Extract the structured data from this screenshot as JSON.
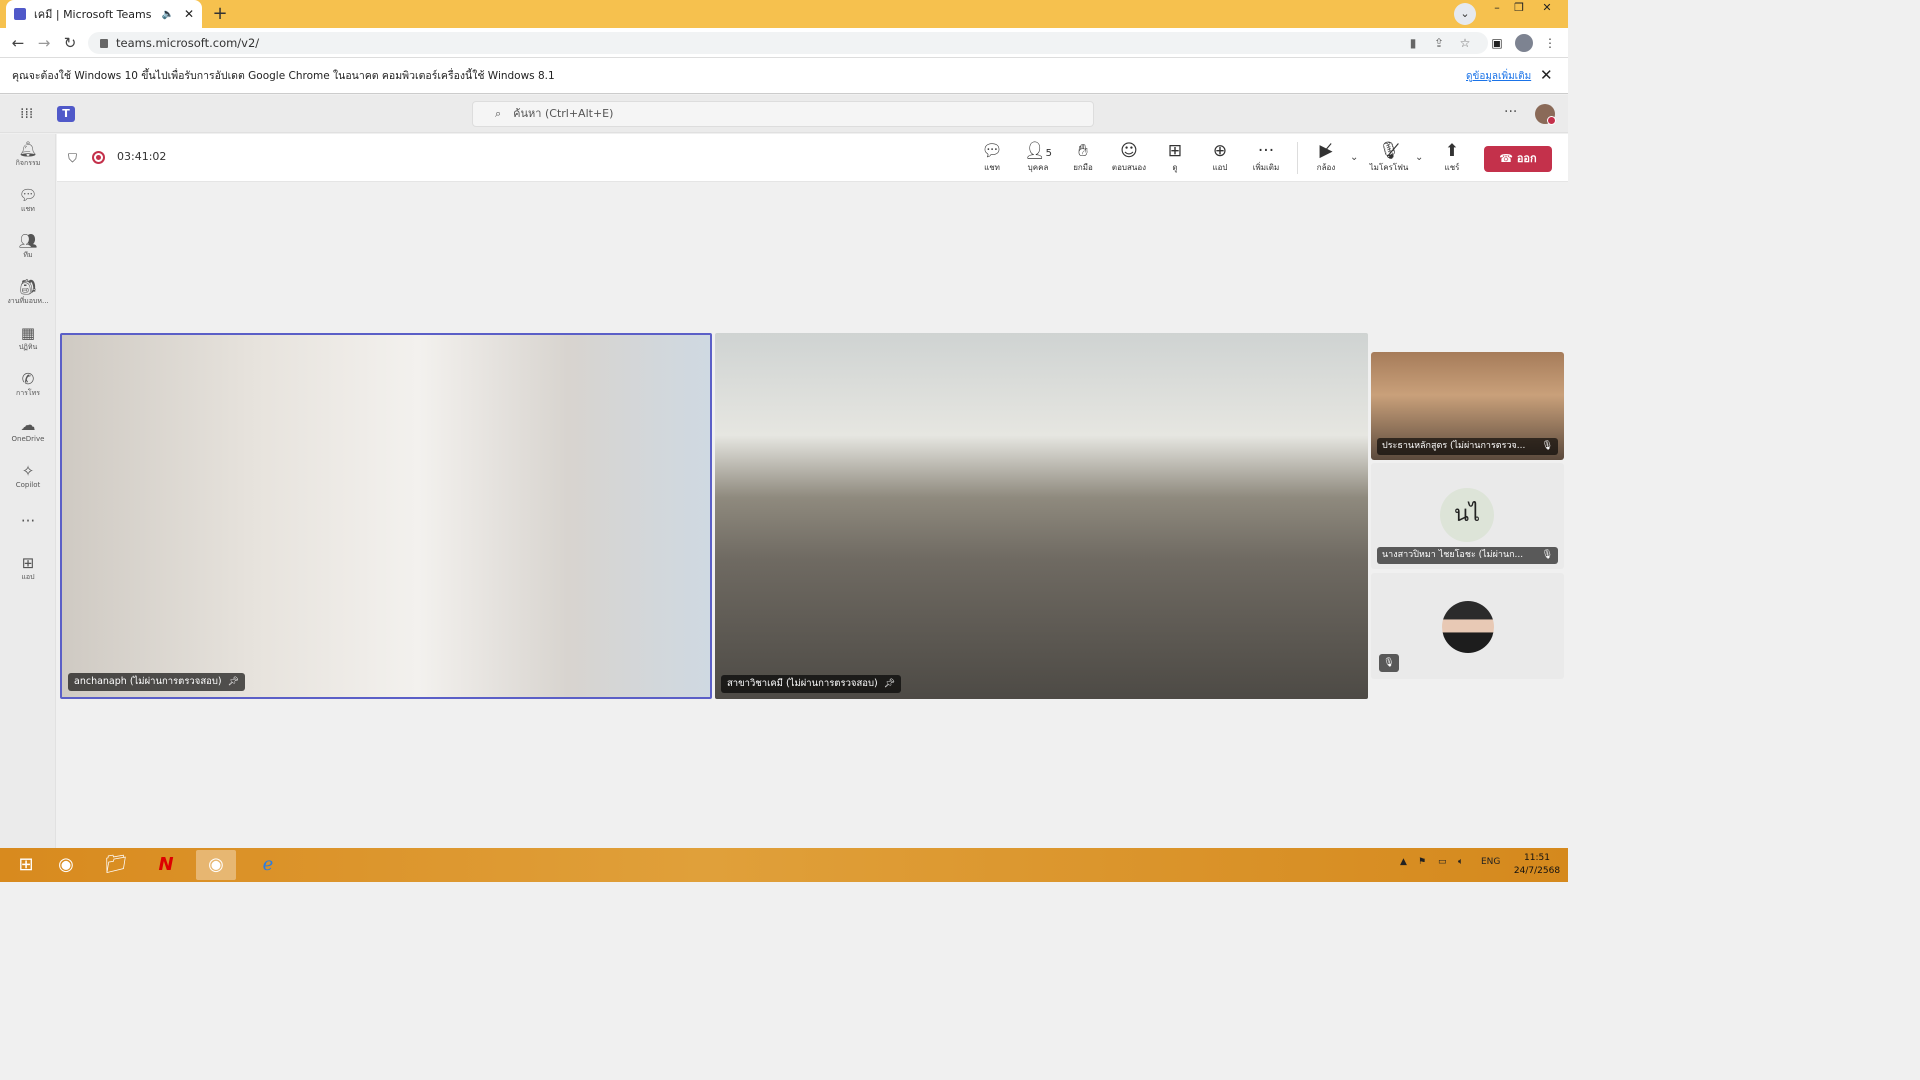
{
  "browser": {
    "tab_title": "เคมี | Microsoft Teams",
    "url": "teams.microsoft.com/v2/",
    "new_tab_symbol": "+",
    "infobar_message": "คุณจะต้องใช้ Windows 10 ขึ้นไปเพื่อรับการอัปเดต Google Chrome ในอนาคต คอมพิวเตอร์เครื่องนี้ใช้ Windows 8.1",
    "infobar_link": "ดูข้อมูลเพิ่มเติม"
  },
  "teams": {
    "search_placeholder": "ค้นหา (Ctrl+Alt+E)",
    "rail": [
      {
        "label": "กิจกรรม",
        "icon": "bell-icon"
      },
      {
        "label": "แชท",
        "icon": "chat-icon"
      },
      {
        "label": "ทีม",
        "icon": "teams-icon"
      },
      {
        "label": "งานที่มอบห...",
        "icon": "assignments-icon"
      },
      {
        "label": "ปฏิทิน",
        "icon": "calendar-icon"
      },
      {
        "label": "การโทร",
        "icon": "phone-icon"
      },
      {
        "label": "OneDrive",
        "icon": "cloud-icon"
      },
      {
        "label": "Copilot",
        "icon": "copilot-icon"
      },
      {
        "label": "",
        "icon": "more-icon"
      },
      {
        "label": "แอป",
        "icon": "add-app-icon"
      }
    ],
    "meeting": {
      "timer": "03:41:02",
      "people_count": "5",
      "tools": {
        "chat": "แชท",
        "people": "บุคคล",
        "raise": "ยกมือ",
        "react": "ตอบสนอง",
        "view": "ดู",
        "apps": "แอป",
        "more": "เพิ่มเติม",
        "camera": "กล้อง",
        "mic": "ไมโครโฟน",
        "share": "แชร์"
      },
      "leave_label": "ออก"
    },
    "participants": {
      "main1": "anchanaph (ไม่ผ่านการตรวจสอบ)",
      "main2": "สาขาวิชาเคมี (ไม่ผ่านการตรวจสอบ)",
      "side1": "ประธานหลักสูตร (ไม่ผ่านการตรวจ...",
      "side2": "นางสาวปิหมา ไชยโอชะ (ไม่ผ่านก...",
      "side2_initials": "นไ"
    }
  },
  "taskbar": {
    "language": "ENG",
    "time": "11:51",
    "date": "24/7/2568"
  },
  "colors": {
    "chrome_frame": "#f6c14e",
    "teams_brand": "#5059c9",
    "active_speaker": "#5b5fc7",
    "leave_red": "#c4314b",
    "taskbar": "#d88a1e"
  }
}
